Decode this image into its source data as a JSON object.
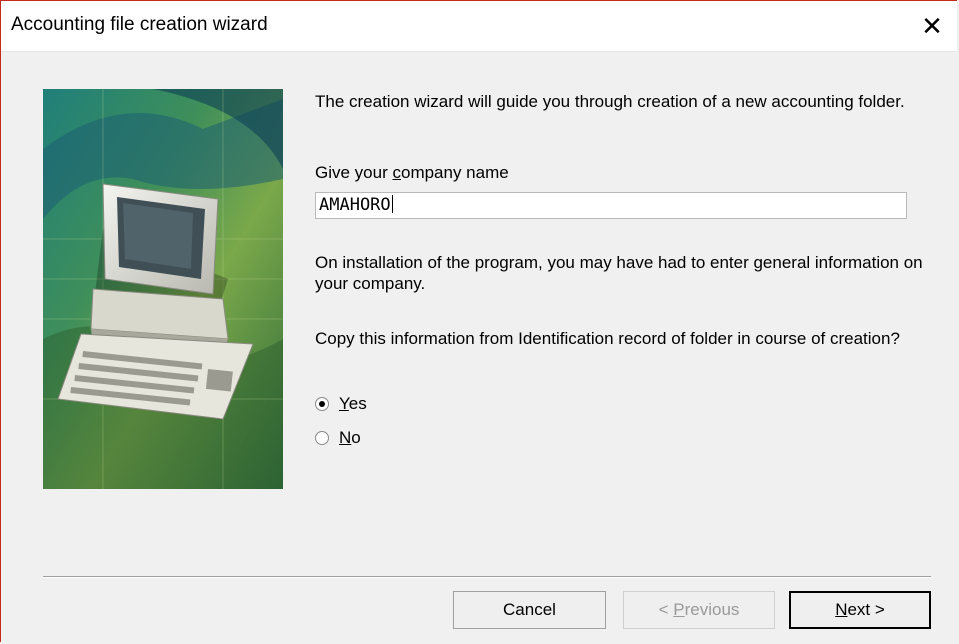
{
  "window": {
    "title": "Accounting file creation wizard",
    "close_glyph": "✕"
  },
  "content": {
    "intro": "The creation wizard will guide you through creation of a new accounting folder.",
    "company_label": {
      "before": "Give your ",
      "accel": "c",
      "after": "ompany name"
    },
    "company_value": "AMAHORO",
    "info_text": "On installation of the program, you may have had to enter general information on your company.",
    "copy_question": "Copy this information from Identification record of folder in course of creation?",
    "options": [
      {
        "accel": "Y",
        "rest": "es",
        "selected": true
      },
      {
        "accel": "N",
        "rest": "o",
        "selected": false
      }
    ]
  },
  "buttons": {
    "cancel": "Cancel",
    "previous": {
      "before": "< ",
      "accel": "P",
      "after": "revious"
    },
    "next": {
      "accel": "N",
      "after": "ext >"
    }
  },
  "icons": {
    "illustration": "computer-keyboard-illustration"
  }
}
